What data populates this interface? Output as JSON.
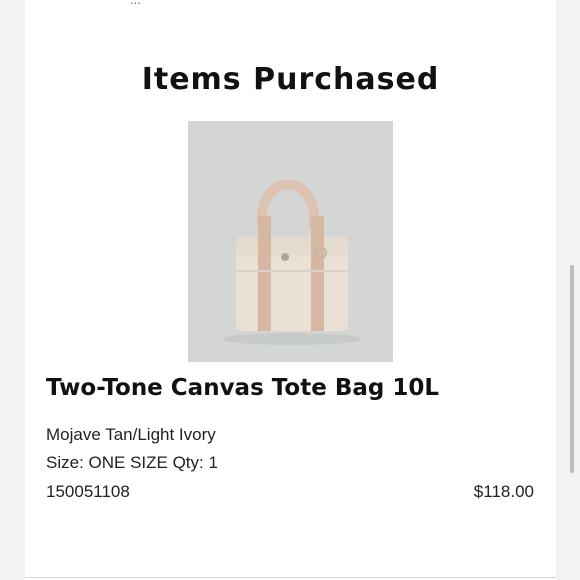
{
  "header": {
    "cutoff_text": "...",
    "title": "Items Purchased"
  },
  "item": {
    "name": "Two-Tone Canvas Tote Bag 10L",
    "color": "Mojave Tan/Light Ivory",
    "size_qty": "Size: ONE SIZE Qty: 1",
    "sku": "150051108",
    "price": "$118.00"
  },
  "colors": {
    "bag_body": "#e9e1d6",
    "straps": "#d6b8a2",
    "background": "#d3d6d3"
  }
}
